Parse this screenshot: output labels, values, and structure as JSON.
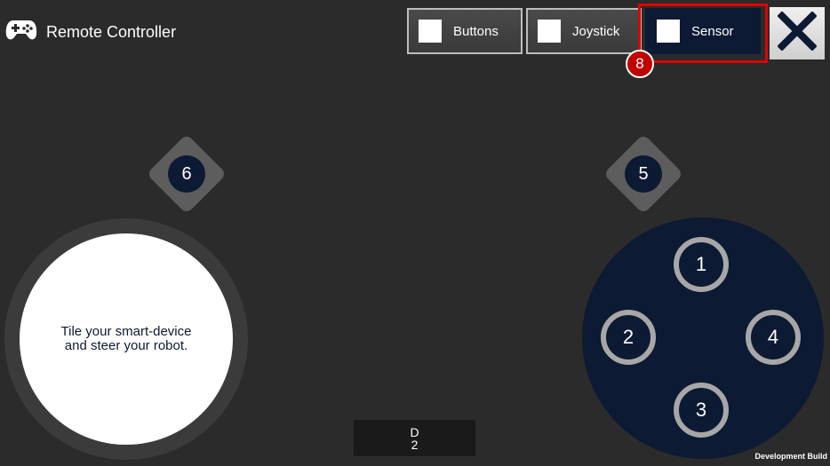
{
  "header": {
    "title": "Remote Controller",
    "icon": "gamepad-icon"
  },
  "modes": [
    {
      "label": "Buttons",
      "active": false
    },
    {
      "label": "Joystick",
      "active": false
    },
    {
      "label": "Sensor",
      "active": true
    }
  ],
  "annotation": {
    "step_number": "8",
    "highlight_color": "#e00000"
  },
  "close": {
    "icon": "close-icon"
  },
  "aux_buttons": {
    "left": "6",
    "right": "5"
  },
  "tilt_area": {
    "text": "Tile your smart-device\nand steer your robot."
  },
  "dpad": {
    "up": "1",
    "left": "2",
    "down": "3",
    "right": "4"
  },
  "debug": {
    "line1": "D",
    "line2": "2"
  },
  "footer": {
    "build_label": "Development Build"
  },
  "colors": {
    "background": "#2b2b2b",
    "accent_navy": "#0d1a33",
    "ring_gray": "#a7a7a7"
  }
}
